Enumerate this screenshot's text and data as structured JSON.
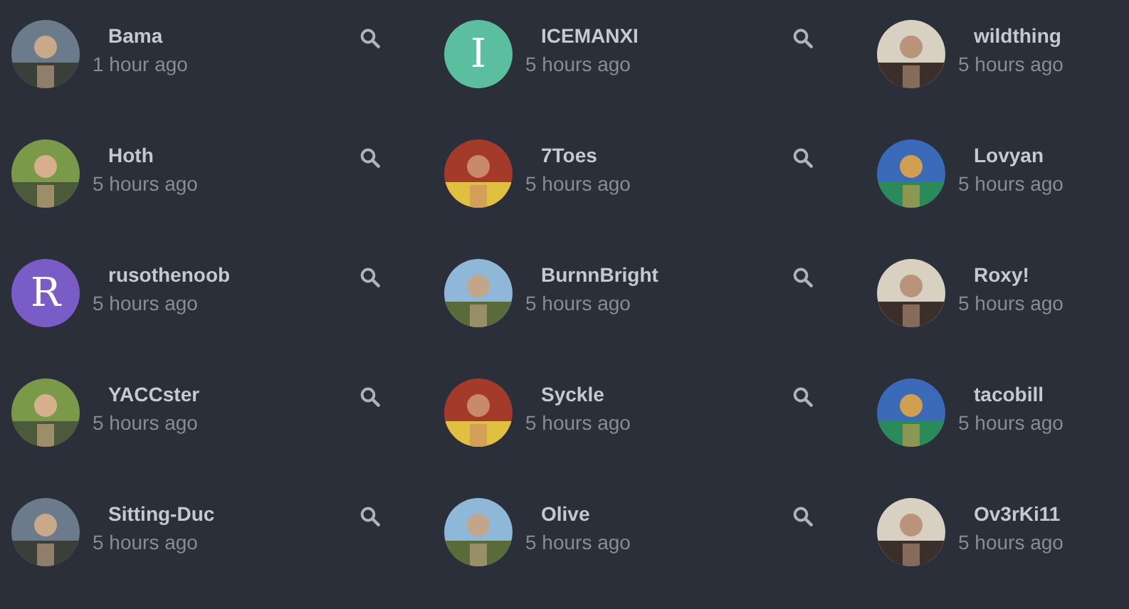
{
  "users": [
    {
      "name": "Bama",
      "time": "1 hour ago",
      "search_button": true
    },
    {
      "name": "ICEMANXI",
      "time": "5 hours ago",
      "avatar": {
        "kind": "letter",
        "letter": "I",
        "color": "#5bbf9f"
      },
      "search_button": true
    },
    {
      "name": "wildthing",
      "time": "5 hours ago",
      "search_button": false
    },
    {
      "name": "Hoth",
      "time": "5 hours ago",
      "search_button": true
    },
    {
      "name": "7Toes",
      "time": "5 hours ago",
      "search_button": true
    },
    {
      "name": "Lovyan",
      "time": "5 hours ago",
      "search_button": false
    },
    {
      "name": "rusothenoob",
      "time": "5 hours ago",
      "avatar": {
        "kind": "letter",
        "letter": "R",
        "color": "#7a5cc6"
      },
      "search_button": true
    },
    {
      "name": "BurnnBright",
      "time": "5 hours ago",
      "search_button": true
    },
    {
      "name": "Roxy!",
      "time": "5 hours ago",
      "search_button": false
    },
    {
      "name": "YACCster",
      "time": "5 hours ago",
      "search_button": true
    },
    {
      "name": "Syckle",
      "time": "5 hours ago",
      "search_button": true
    },
    {
      "name": "tacobill",
      "time": "5 hours ago",
      "search_button": false
    },
    {
      "name": "Sitting-Duc",
      "time": "5 hours ago",
      "search_button": true
    },
    {
      "name": "Olive",
      "time": "5 hours ago",
      "search_button": true
    },
    {
      "name": "Ov3rKi11",
      "time": "5 hours ago",
      "search_button": false
    }
  ]
}
